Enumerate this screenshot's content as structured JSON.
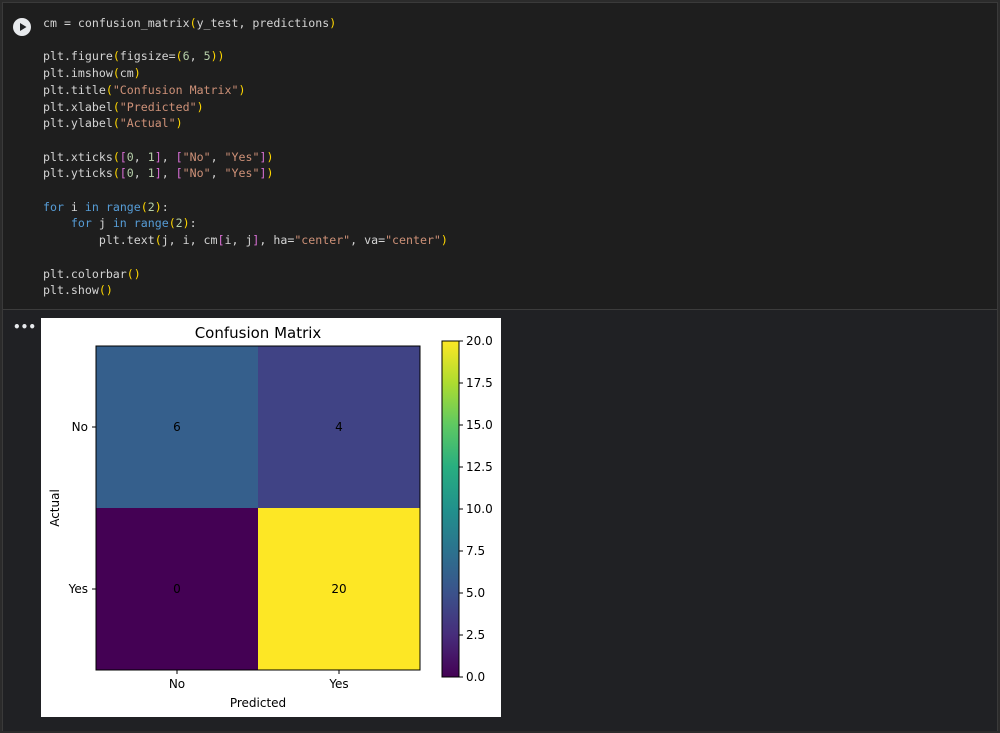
{
  "code_lines": [
    "cm = confusion_matrix(y_test, predictions)",
    "",
    "plt.figure(figsize=(6, 5))",
    "plt.imshow(cm)",
    "plt.title(\"Confusion Matrix\")",
    "plt.xlabel(\"Predicted\")",
    "plt.ylabel(\"Actual\")",
    "",
    "plt.xticks([0, 1], [\"No\", \"Yes\"])",
    "plt.yticks([0, 1], [\"No\", \"Yes\"])",
    "",
    "for i in range(2):",
    "    for j in range(2):",
    "        plt.text(j, i, cm[i, j], ha=\"center\", va=\"center\")",
    "",
    "plt.colorbar()",
    "plt.show()"
  ],
  "output_menu_label": "•••",
  "icons": {
    "run": "play-icon",
    "menu": "more-horiz-icon"
  },
  "colors": {
    "cell_bg": "#202124",
    "code_bg": "#1e1e1e",
    "keyword": "#569cd6",
    "string": "#ce9178"
  },
  "chart_data": {
    "type": "heatmap",
    "title": "Confusion Matrix",
    "xlabel": "Predicted",
    "ylabel": "Actual",
    "x_categories": [
      "No",
      "Yes"
    ],
    "y_categories": [
      "No",
      "Yes"
    ],
    "values": [
      [
        6,
        4
      ],
      [
        0,
        20
      ]
    ],
    "colormap": "viridis",
    "colorbar": {
      "range": [
        0,
        20
      ],
      "ticks": [
        "0.0",
        "2.5",
        "5.0",
        "7.5",
        "10.0",
        "12.5",
        "15.0",
        "17.5",
        "20.0"
      ]
    }
  }
}
